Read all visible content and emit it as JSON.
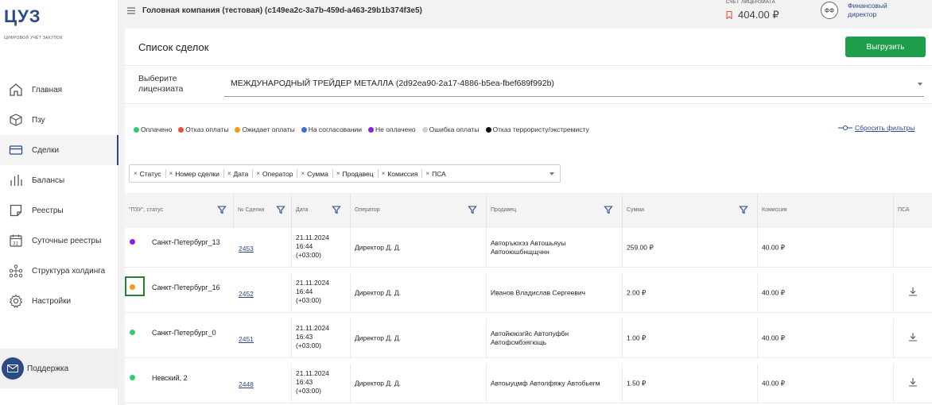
{
  "app": {
    "logo_title": "ЦУЗ",
    "logo_subtitle": "цифровой учёт закупок",
    "company": "Головная компания (тестовая) (c149ea2c-3a7b-459d-a463-29b1b374f3e5)",
    "account_label": "СЧЕТ ЛИЦЕНЗИАТА",
    "account_value": "404.00 ₽",
    "user_initials": "ФФ",
    "user_role": "Финансовый директор"
  },
  "sidebar": {
    "items": [
      {
        "label": "Главная",
        "icon": "home-icon"
      },
      {
        "label": "Пзу",
        "icon": "box-icon"
      },
      {
        "label": "Сделки",
        "icon": "card-icon",
        "active": true
      },
      {
        "label": "Балансы",
        "icon": "bars-icon"
      },
      {
        "label": "Реестры",
        "icon": "registry-icon"
      },
      {
        "label": "Суточные реестры",
        "icon": "calendar-icon"
      },
      {
        "label": "Структура холдинга",
        "icon": "hierarchy-icon"
      },
      {
        "label": "Настройки",
        "icon": "gear-icon"
      }
    ],
    "support_label": "Поддержка"
  },
  "page": {
    "title": "Список сделок",
    "export_label": "Выгрузить",
    "licensee_label": "Выберите лицензиата",
    "licensee_value": "МЕЖДУНАРОДНЫЙ ТРЕЙДЕР МЕТАЛЛА (2d92ea90-2a17-4886-b5ea-fbef689f992b)",
    "reset_label": "Сбросить фильтры"
  },
  "legend": [
    {
      "label": "Оплачено",
      "color": "#2ecc71"
    },
    {
      "label": "Отказ оплаты",
      "color": "#e74c3c"
    },
    {
      "label": "Ожидает оплаты",
      "color": "#f39c12"
    },
    {
      "label": "На согласовании",
      "color": "#3b6fd8"
    },
    {
      "label": "Не оплачено",
      "color": "#8e1ee0"
    },
    {
      "label": "Ошибка оплаты",
      "color": "#cfcfcf"
    },
    {
      "label": "Отказ террористу/экстремисту",
      "color": "#111111"
    }
  ],
  "columns_chips": [
    "Статус",
    "Номер сделки",
    "Дата",
    "Оператор",
    "Сумма",
    "Продавец",
    "Комиссия",
    "ПСА"
  ],
  "table": {
    "headers": [
      "\"ПЗУ\", статус",
      "№ Сделки",
      "Дата",
      "Оператор",
      "Продавец",
      "Сумма",
      "Комиссия",
      "ПСА"
    ],
    "rows": [
      {
        "status_color": "#8e1ee0",
        "pzu": "Санкт-Петербург_13",
        "deal": "2453",
        "date": "21.11.2024",
        "time": "16:44",
        "tz": "(+03:00)",
        "operator": "Директор Д. Д.",
        "seller": "Авторъюхэз Автошьяуы Автооюшбнщщчнн",
        "sum": "259.00 ₽",
        "commission": "40.00 ₽",
        "psa": false
      },
      {
        "status_color": "#f39c12",
        "pzu": "Санкт-Петербург_16",
        "deal": "2452",
        "date": "21.11.2024",
        "time": "16:44",
        "tz": "(+03:00)",
        "operator": "Директор Д. Д.",
        "seller": "Иванов Владислав Сергеевич",
        "sum": "2.00 ₽",
        "commission": "40.00 ₽",
        "psa": true,
        "highlight": true
      },
      {
        "status_color": "#2ecc71",
        "pzu": "Санкт-Петербург_0",
        "deal": "2451",
        "date": "21.11.2024",
        "time": "16:43",
        "tz": "(+03:00)",
        "operator": "Директор Д. Д.",
        "seller": "Автойююзгйс Автопуфбн Автофсмбэягющь",
        "sum": "1.00 ₽",
        "commission": "40.00 ₽",
        "psa": true
      },
      {
        "status_color": "#2ecc71",
        "pzu": "Невский, 2",
        "deal": "2448",
        "date": "21.11.2024",
        "time": "16:43",
        "tz": "(+03:00)",
        "operator": "Директор Д. Д.",
        "seller": "Автоыуцмф Автолфяжу Автобьегм",
        "sum": "1.50 ₽",
        "commission": "40.00 ₽",
        "psa": true
      }
    ]
  }
}
